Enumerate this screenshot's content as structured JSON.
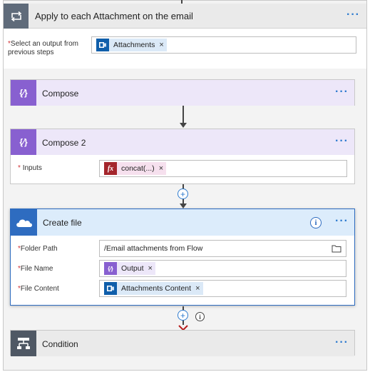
{
  "foreach": {
    "title": "Apply to each Attachment on the email",
    "select_label": "Select an output from previous steps",
    "token_label": "Attachments"
  },
  "compose": {
    "title": "Compose"
  },
  "compose2": {
    "title": "Compose 2",
    "inputs_label": "Inputs",
    "token_label": "concat(...)"
  },
  "create_file": {
    "title": "Create file",
    "folder_path_label": "Folder Path",
    "folder_path_value": "/Email attachments from Flow",
    "file_name_label": "File Name",
    "file_name_token": "Output",
    "file_content_label": "File Content",
    "file_content_token": "Attachments Content"
  },
  "condition": {
    "title": "Condition"
  },
  "symbols": {
    "required_mark": "*",
    "more_dots": "···",
    "remove_x": "×",
    "plus": "+",
    "info": "i",
    "fx": "fx"
  },
  "colors": {
    "compose_purple": "#8860d0",
    "compose_header_bg": "#ede7f9",
    "create_file_blue": "#2e6cc0",
    "create_file_header_bg": "#dcecfb",
    "outlook_blue": "#0f5eaa",
    "fx_magenta": "#a4262c",
    "condition_gray": "#4f5864",
    "accent_blue": "#2e7bcf"
  }
}
